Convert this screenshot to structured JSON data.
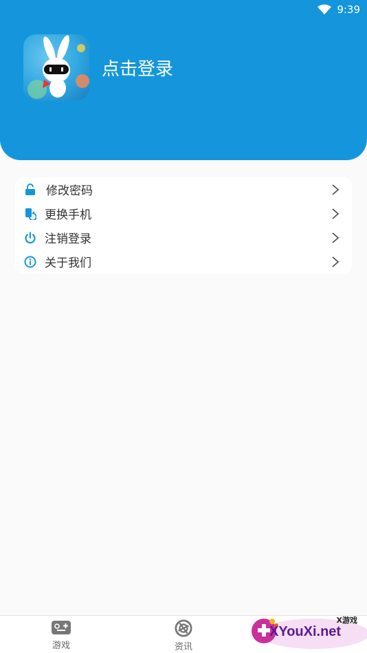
{
  "status_bar": {
    "time": "9:39"
  },
  "profile": {
    "login_prompt": "点击登录"
  },
  "menu": {
    "items": [
      {
        "label": "修改密码",
        "icon": "lock-icon"
      },
      {
        "label": "更换手机",
        "icon": "phone-swap-icon"
      },
      {
        "label": "注销登录",
        "icon": "power-icon"
      },
      {
        "label": "关于我们",
        "icon": "info-icon"
      }
    ]
  },
  "tabs": [
    {
      "label": "游戏",
      "icon": "gamepad-icon"
    },
    {
      "label": "资讯",
      "icon": "news-icon"
    }
  ],
  "watermark": {
    "brand": "XYouXi.net",
    "tag": "X游戏"
  },
  "colors": {
    "primary": "#1596dc",
    "background": "#fafafa"
  }
}
